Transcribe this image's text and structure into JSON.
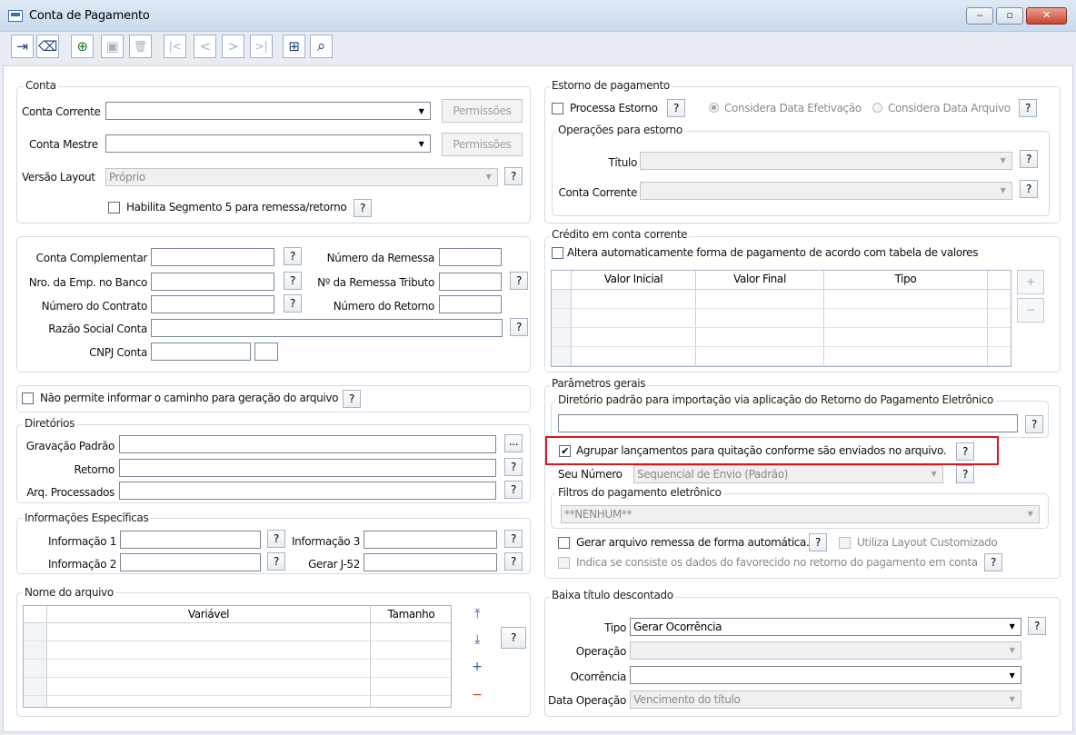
{
  "window": {
    "title": "Conta de Pagamento",
    "minimize": "‒",
    "maximize": "▫",
    "close": "✕"
  },
  "toolbar": {
    "exit_icon": "⇥",
    "eraser_icon": "⌫",
    "add_icon": "⊕",
    "save_icon": "▣",
    "delete_icon": "🗑",
    "first_icon": "|<",
    "prev_icon": "<",
    "next_icon": ">",
    "last_icon": ">|",
    "grid_icon": "⊞",
    "search_icon": "⌕"
  },
  "help": "?",
  "conta": {
    "legend": "Conta",
    "conta_corrente_label": "Conta Corrente",
    "conta_corrente_value": "",
    "conta_mestre_label": "Conta Mestre",
    "conta_mestre_value": "",
    "permissoes": "Permissões",
    "versao_layout_label": "Versão Layout",
    "versao_layout_value": "Próprio",
    "segmento5_label": "Habilita Segmento 5 para remessa/retorno",
    "segmento5_checked": false
  },
  "complementar": {
    "conta_complementar": "Conta Complementar",
    "nro_emp_banco": "Nro. da Emp. no Banco",
    "numero_contrato": "Número do Contrato",
    "razao_social": "Razão Social Conta",
    "cnpj_conta": "CNPJ Conta",
    "numero_remessa": "Número da Remessa",
    "remessa_tributo": "Nº da Remessa Tributo",
    "numero_retorno": "Número do Retorno"
  },
  "nao_permite": {
    "label": "Não permite informar o caminho para geração do arquivo",
    "checked": false
  },
  "diretorios": {
    "legend": "Diretórios",
    "gravacao_padrao": "Gravação Padrão",
    "retorno": "Retorno",
    "arq_processados": "Arq. Processados",
    "browse": "..."
  },
  "info_especificas": {
    "legend": "Informações Específicas",
    "informacao1": "Informação 1",
    "informacao2": "Informação 2",
    "informacao3": "Informação 3",
    "gerar_j52": "Gerar J-52"
  },
  "nome_arquivo": {
    "legend": "Nome do arquivo",
    "columns": [
      "Variável",
      "Tamanho"
    ],
    "move_up": "⤒",
    "move_down": "⤓",
    "add_row": "+",
    "remove_row": "−"
  },
  "estorno": {
    "legend": "Estorno de pagamento",
    "processa_estorno": "Processa Estorno",
    "processa_checked": false,
    "considera_data_efetivacao": "Considera Data Efetivação",
    "considera_data_arquivo": "Considera Data Arquivo",
    "selected": "efetivacao",
    "operacoes_legend": "Operações para estorno",
    "titulo": "Título",
    "conta_corrente": "Conta Corrente"
  },
  "credito": {
    "legend": "Crédito em conta corrente",
    "altera_label": "Altera automaticamente forma de pagamento de acordo com tabela de valores",
    "altera_checked": false,
    "columns": [
      "Valor Inicial",
      "Valor Final",
      "Tipo"
    ],
    "add_row": "+",
    "remove_row": "−"
  },
  "parametros": {
    "legend": "Parâmetros gerais",
    "diretorio_legend": "Diretório padrão para importação via aplicação do Retorno do Pagamento Eletrônico",
    "diretorio_value": "",
    "agrupar_label": "Agrupar lançamentos para quitação conforme são enviados no arquivo.",
    "agrupar_checked": true,
    "seu_numero_label": "Seu Número",
    "seu_numero_value": "Sequencial de Envio (Padrão)",
    "filtros_legend": "Filtros do pagamento eletrônico",
    "filtros_value": "**NENHUM**",
    "gerar_remessa_label": "Gerar arquivo remessa de forma automática.",
    "utiliza_layout_label": "Utiliza Layout Customizado",
    "indica_label": "Indica se consiste os dados do favorecido no retorno do pagamento em conta",
    "check_mark": "✔"
  },
  "baixa": {
    "legend": "Baixa título descontado",
    "tipo_label": "Tipo",
    "tipo_value": "Gerar Ocorrência",
    "operacao_label": "Operação",
    "operacao_value": "",
    "ocorrencia_label": "Ocorrência",
    "ocorrencia_value": "",
    "data_operacao_label": "Data Operação",
    "data_operacao_value": "Vencimento do título"
  }
}
